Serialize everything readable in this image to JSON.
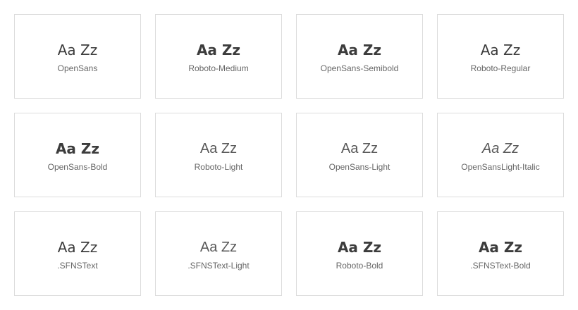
{
  "fonts": [
    {
      "sample": "Aa Zz",
      "name": "OpenSans"
    },
    {
      "sample": "Aa Zz",
      "name": "Roboto-Medium"
    },
    {
      "sample": "Aa Zz",
      "name": "OpenSans-Semibold"
    },
    {
      "sample": "Aa Zz",
      "name": "Roboto-Regular"
    },
    {
      "sample": "Aa Zz",
      "name": "OpenSans-Bold"
    },
    {
      "sample": "Aa Zz",
      "name": "Roboto-Light"
    },
    {
      "sample": "Aa Zz",
      "name": "OpenSans-Light"
    },
    {
      "sample": "Aa Zz",
      "name": "OpenSansLight-Italic"
    },
    {
      "sample": "Aa Zz",
      "name": ".SFNSText"
    },
    {
      "sample": "Aa Zz",
      "name": ".SFNSText-Light"
    },
    {
      "sample": "Aa Zz",
      "name": "Roboto-Bold"
    },
    {
      "sample": "Aa Zz",
      "name": ".SFNSText-Bold"
    }
  ],
  "colors": {
    "border": "#dcdcdc",
    "sample_text": "#3c3c3c",
    "label_text": "#666666"
  }
}
